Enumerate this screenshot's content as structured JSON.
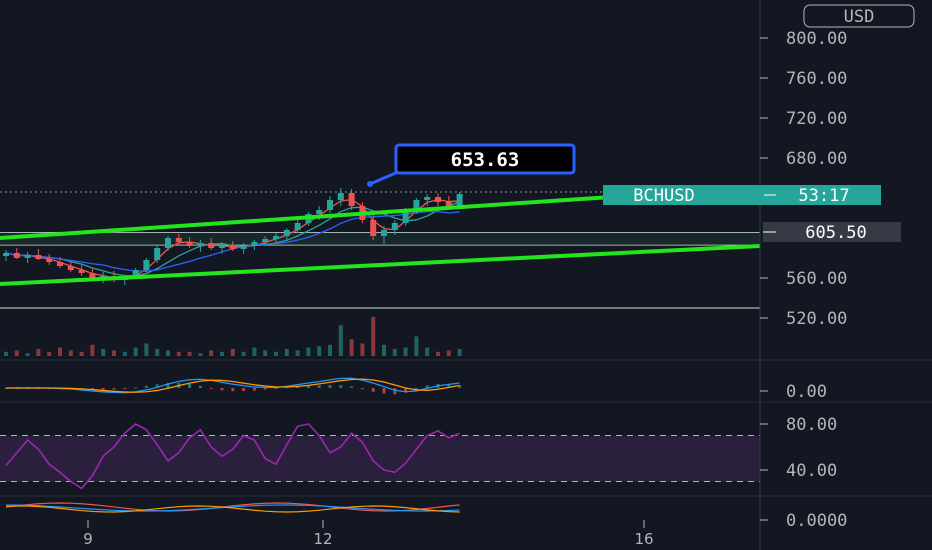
{
  "currency": "USD",
  "symbol": "BCHUSD",
  "countdown": "53:17",
  "callout_price": "653.63",
  "level_price": "605.50",
  "colors": {
    "background": "#131722",
    "bull": "#26a69a",
    "bear": "#ef5350",
    "trendline": "#22e51b",
    "symbol_tag": "#26a69a",
    "level_tag": "#363a45",
    "callout_border": "#2962ff",
    "callout_fill": "#000000",
    "ma_fast": "#ef5350",
    "ma_mid": "#26a69a",
    "ma_slow": "#2962ff",
    "macd_line": "#2196f3",
    "signal_line": "#ff9800",
    "rsi_line": "#9c27b0",
    "rsi_band": "#2a1f3d"
  },
  "chart_data": [
    {
      "type": "candlestick",
      "pane": "price",
      "y_axis_labels": [
        "800.00",
        "760.00",
        "720.00",
        "680.00",
        "560.00",
        "520.00"
      ],
      "x_axis_labels": [
        "9",
        "12",
        "16"
      ],
      "ylim": [
        500,
        820
      ],
      "horizontal_lines": [
        646,
        605.5,
        593,
        530
      ],
      "channel_upper": [
        [
          0,
          600
        ],
        [
          760,
          651
        ]
      ],
      "channel_lower": [
        [
          0,
          554
        ],
        [
          760,
          592
        ]
      ],
      "ma_series": [
        "ma_fast",
        "ma_mid",
        "ma_slow"
      ],
      "candles": [
        {
          "o": 582,
          "h": 588,
          "l": 577,
          "c": 585
        },
        {
          "o": 585,
          "h": 590,
          "l": 579,
          "c": 580
        },
        {
          "o": 580,
          "h": 586,
          "l": 575,
          "c": 583
        },
        {
          "o": 583,
          "h": 589,
          "l": 578,
          "c": 579
        },
        {
          "o": 579,
          "h": 584,
          "l": 573,
          "c": 576
        },
        {
          "o": 576,
          "h": 581,
          "l": 570,
          "c": 572
        },
        {
          "o": 572,
          "h": 577,
          "l": 566,
          "c": 568
        },
        {
          "o": 568,
          "h": 573,
          "l": 562,
          "c": 565
        },
        {
          "o": 565,
          "h": 570,
          "l": 558,
          "c": 560
        },
        {
          "o": 560,
          "h": 566,
          "l": 555,
          "c": 562
        },
        {
          "o": 562,
          "h": 567,
          "l": 556,
          "c": 558
        },
        {
          "o": 558,
          "h": 563,
          "l": 553,
          "c": 561
        },
        {
          "o": 561,
          "h": 570,
          "l": 559,
          "c": 568
        },
        {
          "o": 568,
          "h": 580,
          "l": 566,
          "c": 578
        },
        {
          "o": 578,
          "h": 592,
          "l": 575,
          "c": 590
        },
        {
          "o": 590,
          "h": 602,
          "l": 587,
          "c": 600
        },
        {
          "o": 600,
          "h": 604,
          "l": 593,
          "c": 596
        },
        {
          "o": 596,
          "h": 601,
          "l": 590,
          "c": 592
        },
        {
          "o": 592,
          "h": 598,
          "l": 586,
          "c": 595
        },
        {
          "o": 595,
          "h": 600,
          "l": 588,
          "c": 590
        },
        {
          "o": 590,
          "h": 596,
          "l": 584,
          "c": 593
        },
        {
          "o": 593,
          "h": 597,
          "l": 587,
          "c": 589
        },
        {
          "o": 589,
          "h": 595,
          "l": 584,
          "c": 592
        },
        {
          "o": 592,
          "h": 598,
          "l": 588,
          "c": 596
        },
        {
          "o": 596,
          "h": 602,
          "l": 592,
          "c": 599
        },
        {
          "o": 599,
          "h": 605,
          "l": 595,
          "c": 602
        },
        {
          "o": 602,
          "h": 610,
          "l": 598,
          "c": 608
        },
        {
          "o": 608,
          "h": 618,
          "l": 605,
          "c": 615
        },
        {
          "o": 615,
          "h": 626,
          "l": 612,
          "c": 624
        },
        {
          "o": 624,
          "h": 632,
          "l": 618,
          "c": 628
        },
        {
          "o": 628,
          "h": 642,
          "l": 625,
          "c": 638
        },
        {
          "o": 638,
          "h": 650,
          "l": 632,
          "c": 645
        },
        {
          "o": 645,
          "h": 649,
          "l": 628,
          "c": 632
        },
        {
          "o": 632,
          "h": 636,
          "l": 615,
          "c": 618
        },
        {
          "o": 618,
          "h": 625,
          "l": 598,
          "c": 602
        },
        {
          "o": 602,
          "h": 612,
          "l": 594,
          "c": 608
        },
        {
          "o": 608,
          "h": 618,
          "l": 603,
          "c": 615
        },
        {
          "o": 615,
          "h": 630,
          "l": 612,
          "c": 628
        },
        {
          "o": 628,
          "h": 640,
          "l": 624,
          "c": 638
        },
        {
          "o": 638,
          "h": 644,
          "l": 632,
          "c": 641
        },
        {
          "o": 641,
          "h": 645,
          "l": 632,
          "c": 636
        },
        {
          "o": 636,
          "h": 642,
          "l": 628,
          "c": 632
        },
        {
          "o": 632,
          "h": 646,
          "l": 629,
          "c": 644
        }
      ],
      "volume": [
        3,
        4,
        2,
        5,
        3,
        6,
        4,
        3,
        8,
        5,
        4,
        3,
        6,
        9,
        5,
        4,
        3,
        3,
        2,
        4,
        3,
        5,
        3,
        6,
        4,
        3,
        5,
        4,
        6,
        7,
        8,
        22,
        12,
        9,
        28,
        8,
        5,
        6,
        14,
        6,
        3,
        4,
        5
      ]
    },
    {
      "type": "line",
      "pane": "macd",
      "y_axis_labels": [
        "0.00"
      ],
      "series": [
        {
          "key": "macd_line"
        },
        {
          "key": "signal_line"
        }
      ]
    },
    {
      "type": "line",
      "pane": "rsi",
      "y_axis_labels": [
        "80.00",
        "40.00"
      ],
      "bands": [
        70,
        30
      ],
      "values": [
        44,
        55,
        66,
        58,
        45,
        38,
        30,
        24,
        35,
        52,
        60,
        72,
        80,
        75,
        62,
        48,
        55,
        68,
        75,
        60,
        52,
        58,
        70,
        66,
        50,
        45,
        62,
        78,
        80,
        70,
        55,
        60,
        72,
        64,
        48,
        40,
        38,
        46,
        58,
        70,
        74,
        68,
        72
      ]
    },
    {
      "type": "line",
      "pane": "dmi",
      "y_axis_labels": [
        "0.0000"
      ],
      "series": [
        {
          "key": "ma_fast"
        },
        {
          "key": "macd_line"
        },
        {
          "key": "signal_line"
        }
      ]
    }
  ]
}
